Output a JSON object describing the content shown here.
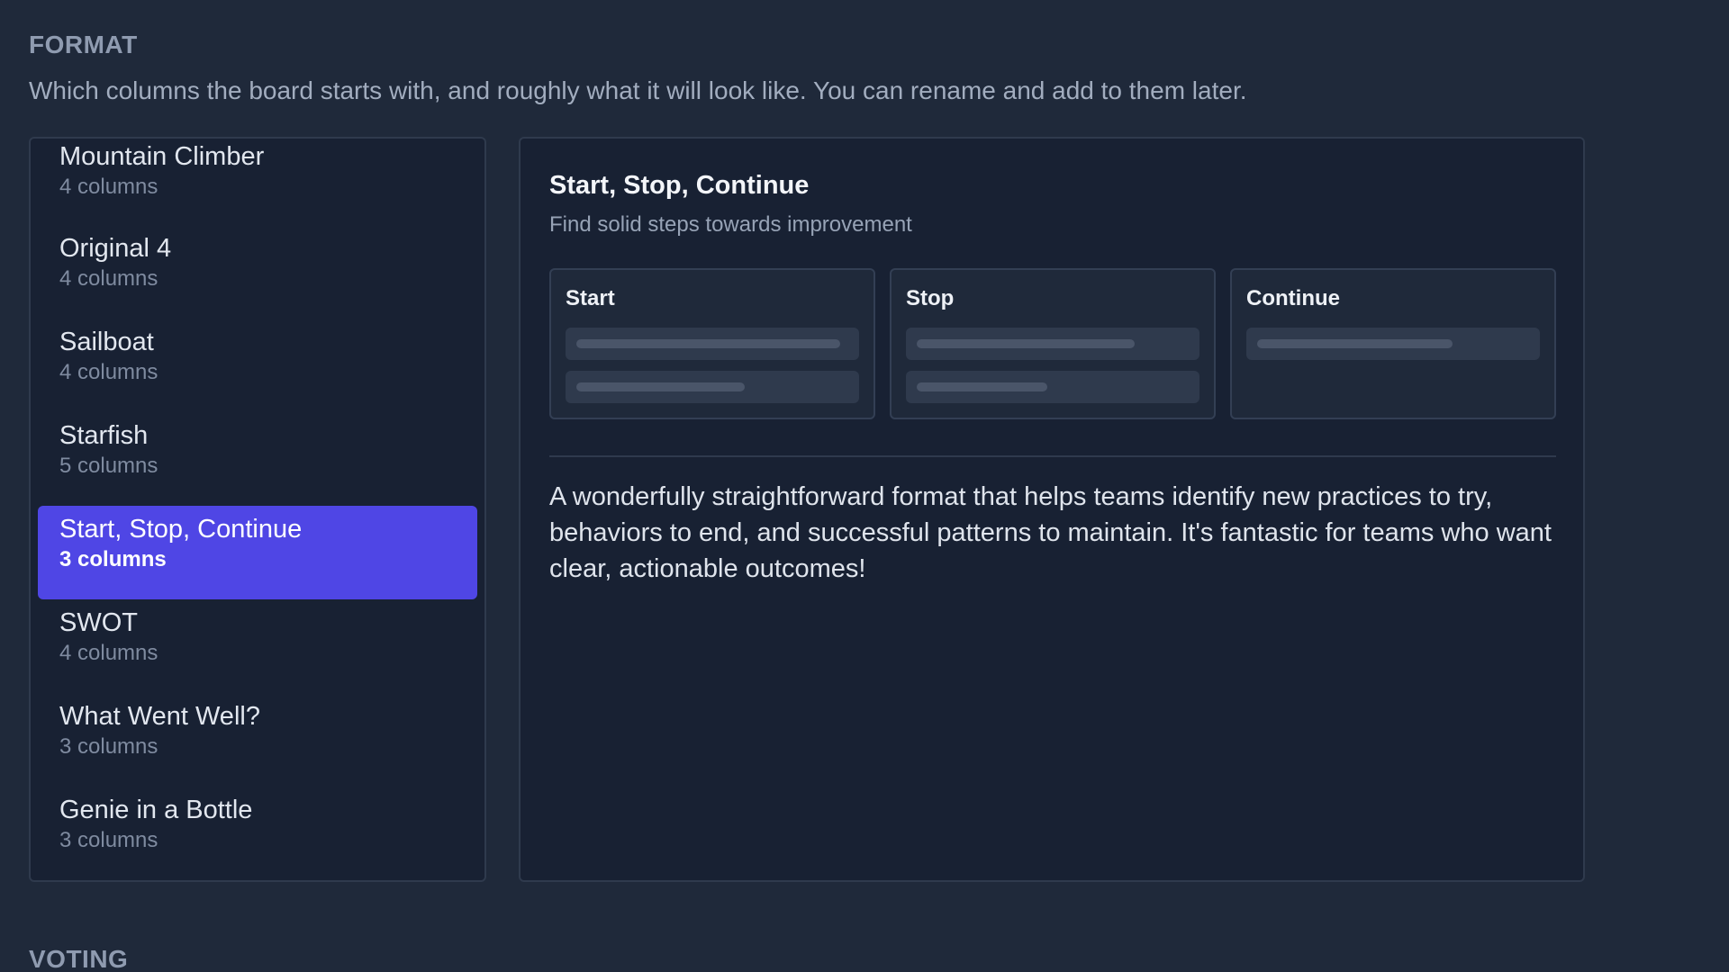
{
  "format_section": {
    "title": "FORMAT",
    "description": "Which columns the board starts with, and roughly what it will look like. You can rename and add to them later."
  },
  "formats": [
    {
      "name": "Mountain Climber",
      "columns": "4 columns",
      "selected": false
    },
    {
      "name": "Original 4",
      "columns": "4 columns",
      "selected": false
    },
    {
      "name": "Sailboat",
      "columns": "4 columns",
      "selected": false
    },
    {
      "name": "Starfish",
      "columns": "5 columns",
      "selected": false
    },
    {
      "name": "Start, Stop, Continue",
      "columns": "3 columns",
      "selected": true
    },
    {
      "name": "SWOT",
      "columns": "4 columns",
      "selected": false
    },
    {
      "name": "What Went Well?",
      "columns": "3 columns",
      "selected": false
    },
    {
      "name": "Genie in a Bottle",
      "columns": "3 columns",
      "selected": false
    }
  ],
  "preview": {
    "title": "Start, Stop, Continue",
    "subtitle": "Find solid steps towards improvement",
    "columns": [
      {
        "label": "Start",
        "placeholder_cards": [
          0.97,
          0.62
        ]
      },
      {
        "label": "Stop",
        "placeholder_cards": [
          0.8,
          0.48
        ]
      },
      {
        "label": "Continue",
        "placeholder_cards": [
          0.72
        ]
      }
    ],
    "description": "A wonderfully straightforward format that helps teams identify new practices to try, behaviors to end, and successful patterns to maintain. It's fantastic for teams who want clear, actionable outcomes!"
  },
  "voting_section": {
    "title": "VOTING"
  },
  "colors": {
    "background": "#1f293a",
    "panel": "#182133",
    "selected": "#4f46e5"
  }
}
